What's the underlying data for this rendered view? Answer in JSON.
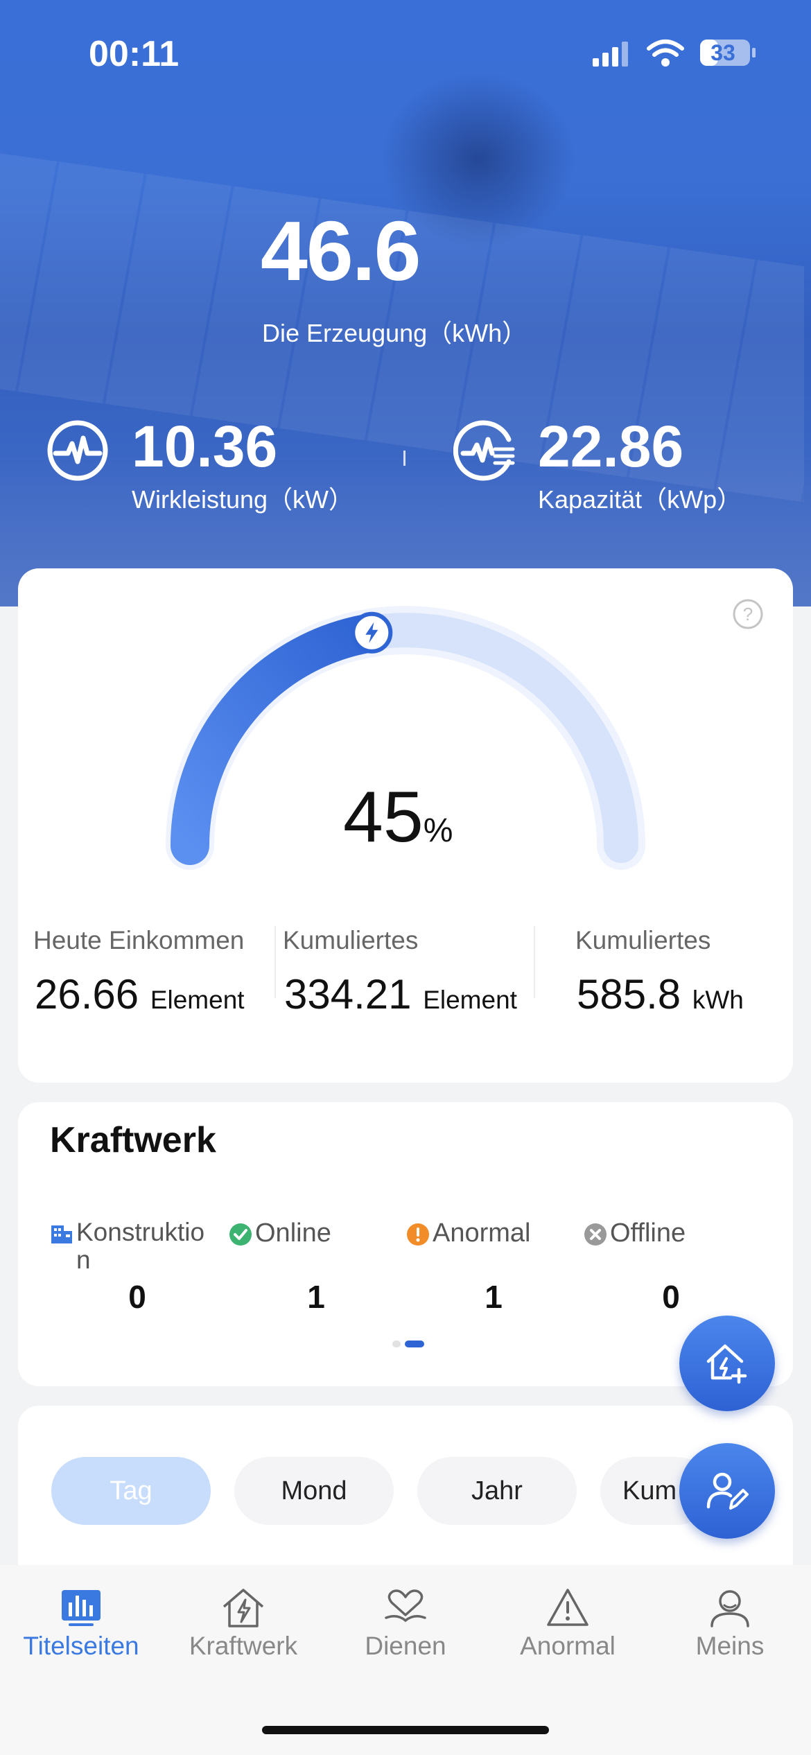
{
  "status_bar": {
    "time": "00:11",
    "battery": "33"
  },
  "hero": {
    "generation_value": "46.6",
    "generation_label": "Die Erzeugung（kWh）",
    "active_power_value": "10.36",
    "active_power_label": "Wirkleistung（kW）",
    "capacity_value": "22.86",
    "capacity_label": "Kapazität（kWp）"
  },
  "gauge": {
    "percent_value": "45",
    "percent_sign": "%",
    "fill_fraction": 0.45
  },
  "metrics": [
    {
      "label": "Heute Einkommen",
      "value": "26.66",
      "unit": "Element"
    },
    {
      "label": "Kumuliertes",
      "value": "334.21",
      "unit": "Element"
    },
    {
      "label": "Kumuliertes",
      "value": "585.8",
      "unit": "kWh"
    }
  ],
  "kraftwerk": {
    "title": "Kraftwerk",
    "statuses": [
      {
        "label": "Konstruktio\nn",
        "count": "0",
        "icon": "building-icon"
      },
      {
        "label": "Online",
        "count": "1",
        "icon": "check-circle-icon",
        "color": "#3cb371"
      },
      {
        "label": "Anormal",
        "count": "1",
        "icon": "warning-circle-icon",
        "color": "#f28c28"
      },
      {
        "label": "Offline",
        "count": "0",
        "icon": "close-circle-icon",
        "color": "#999999"
      }
    ]
  },
  "period_tabs": [
    "Tag",
    "Mond",
    "Jahr",
    "Kum"
  ],
  "fabs": {
    "add_station": "home-add-icon",
    "edit_profile": "user-edit-icon"
  },
  "tabbar": [
    {
      "label": "Titelseiten",
      "icon": "chart-icon",
      "active": true
    },
    {
      "label": "Kraftwerk",
      "icon": "house-bolt-icon",
      "active": false
    },
    {
      "label": "Dienen",
      "icon": "heart-hand-icon",
      "active": false
    },
    {
      "label": "Anormal",
      "icon": "warning-triangle-icon",
      "active": false
    },
    {
      "label": "Meins",
      "icon": "user-icon",
      "active": false
    }
  ],
  "colors": {
    "accent": "#3a79e0",
    "hero": "#3a6fd8"
  }
}
